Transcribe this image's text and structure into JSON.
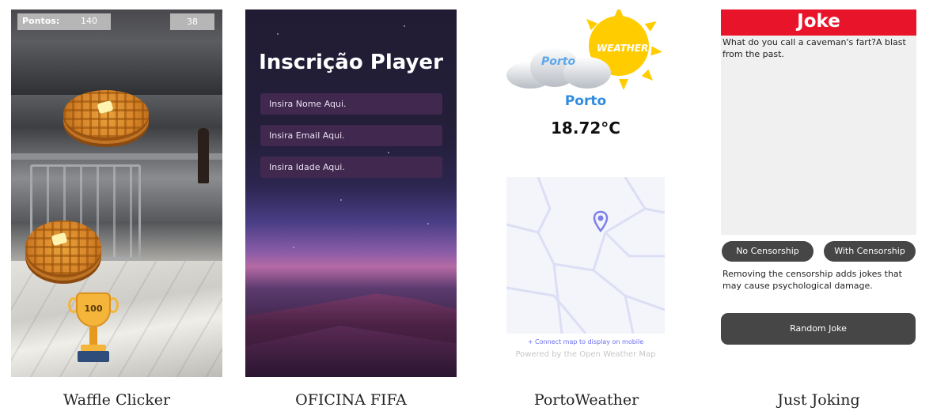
{
  "projects": [
    {
      "id": "waffle",
      "caption": "Waffle Clicker",
      "points_label": "Pontos:",
      "points_value": "140",
      "timer_value": "38",
      "trophy_value": "100"
    },
    {
      "id": "fifa",
      "caption": "OFICINA FIFA",
      "title": "Inscrição Player",
      "name_placeholder": "Insira Nome Aqui.",
      "email_placeholder": "Insira Email Aqui.",
      "age_placeholder": "Insira Idade Aqui."
    },
    {
      "id": "weather",
      "caption": "PortoWeather",
      "logo_cloud_text": "Porto",
      "logo_sun_text": "WEATHER",
      "city": "Porto",
      "temperature": "18.72°C",
      "map_link": "+ Connect map to display on mobile",
      "powered_by": "Powered by the Open Weather Map"
    },
    {
      "id": "joke",
      "caption": "Just Joking",
      "header": "Joke",
      "joke_text": "What do you call a caveman's fart?A blast from the past.",
      "no_censorship_label": "No Censorship",
      "with_censorship_label": "With Censorship",
      "censorship_note": "Removing the censorship adds jokes that may cause psychological damage.",
      "random_label": "Random Joke"
    }
  ],
  "colors": {
    "joke_header": "#e8152a",
    "joke_button": "#464646",
    "weather_city": "#2f8be0",
    "sun": "#ffcc00",
    "map_pin": "#7c80ea"
  }
}
